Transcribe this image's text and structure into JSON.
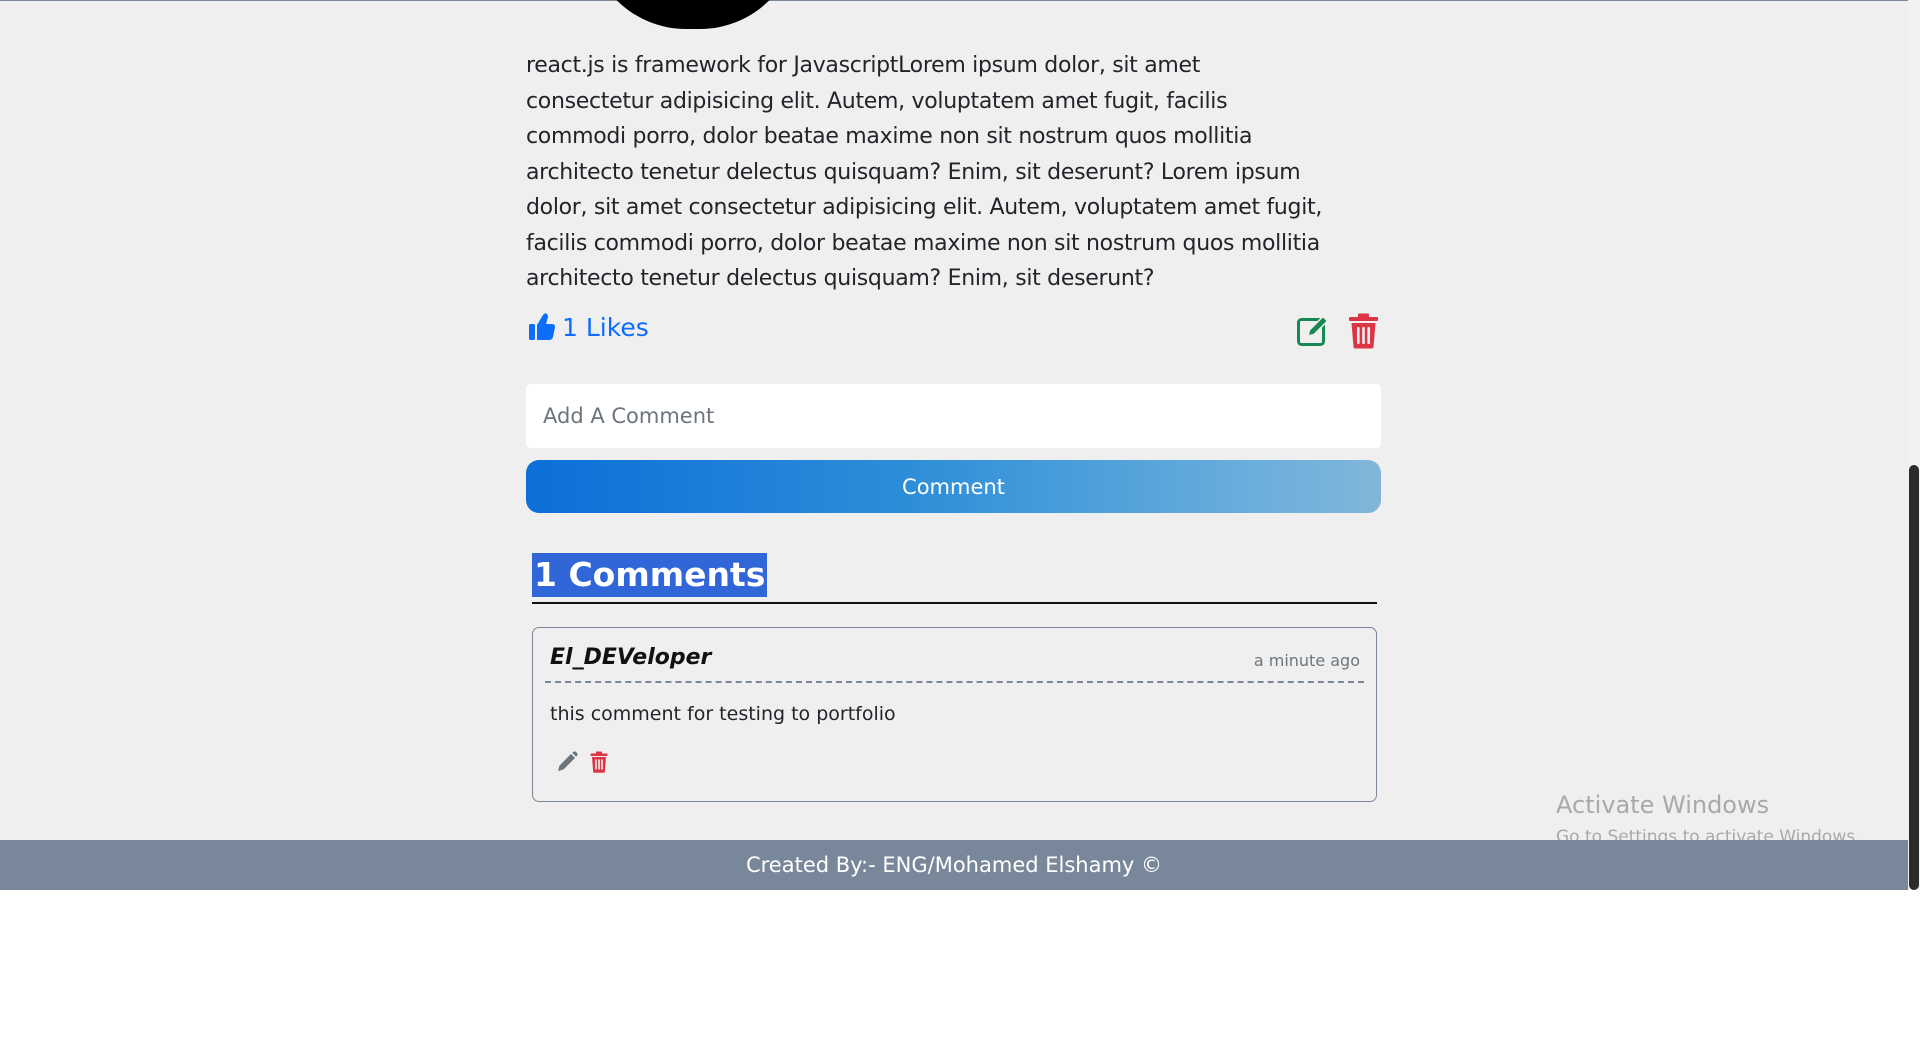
{
  "post": {
    "body": "react.js is framework for JavascriptLorem ipsum dolor, sit amet consectetur adipisicing elit. Autem, voluptatem amet fugit, facilis commodi porro, dolor beatae maxime non sit nostrum quos mollitia architecto tenetur delectus quisquam? Enim, sit deserunt? Lorem ipsum dolor, sit amet consectetur adipisicing elit. Autem, voluptatem amet fugit, facilis commodi porro, dolor beatae maxime non sit nostrum quos mollitia architecto tenetur delectus quisquam? Enim, sit deserunt?",
    "likes_label": "1 Likes",
    "like_icon": "thumbs-up-icon",
    "edit_icon": "edit-icon",
    "delete_icon": "trash-icon"
  },
  "comment_form": {
    "placeholder": "Add A Comment",
    "button_label": "Comment"
  },
  "comments": {
    "title": "1 Comments",
    "items": [
      {
        "author": "El_DEVeloper",
        "time": "a minute ago",
        "text": "this comment for testing to portfolio",
        "edit_icon": "pencil-icon",
        "delete_icon": "trash-icon"
      }
    ]
  },
  "footer": {
    "text": "Created By:- ENG/Mohamed Elshamy ©"
  },
  "watermark": {
    "title": "Activate Windows",
    "subtitle": "Go to Settings to activate Windows."
  },
  "colors": {
    "like_blue": "#0d6efd",
    "edit_green": "#198754",
    "delete_red": "#dc3545",
    "highlight_blue": "#3166d9",
    "footer_gray": "#78889a"
  }
}
